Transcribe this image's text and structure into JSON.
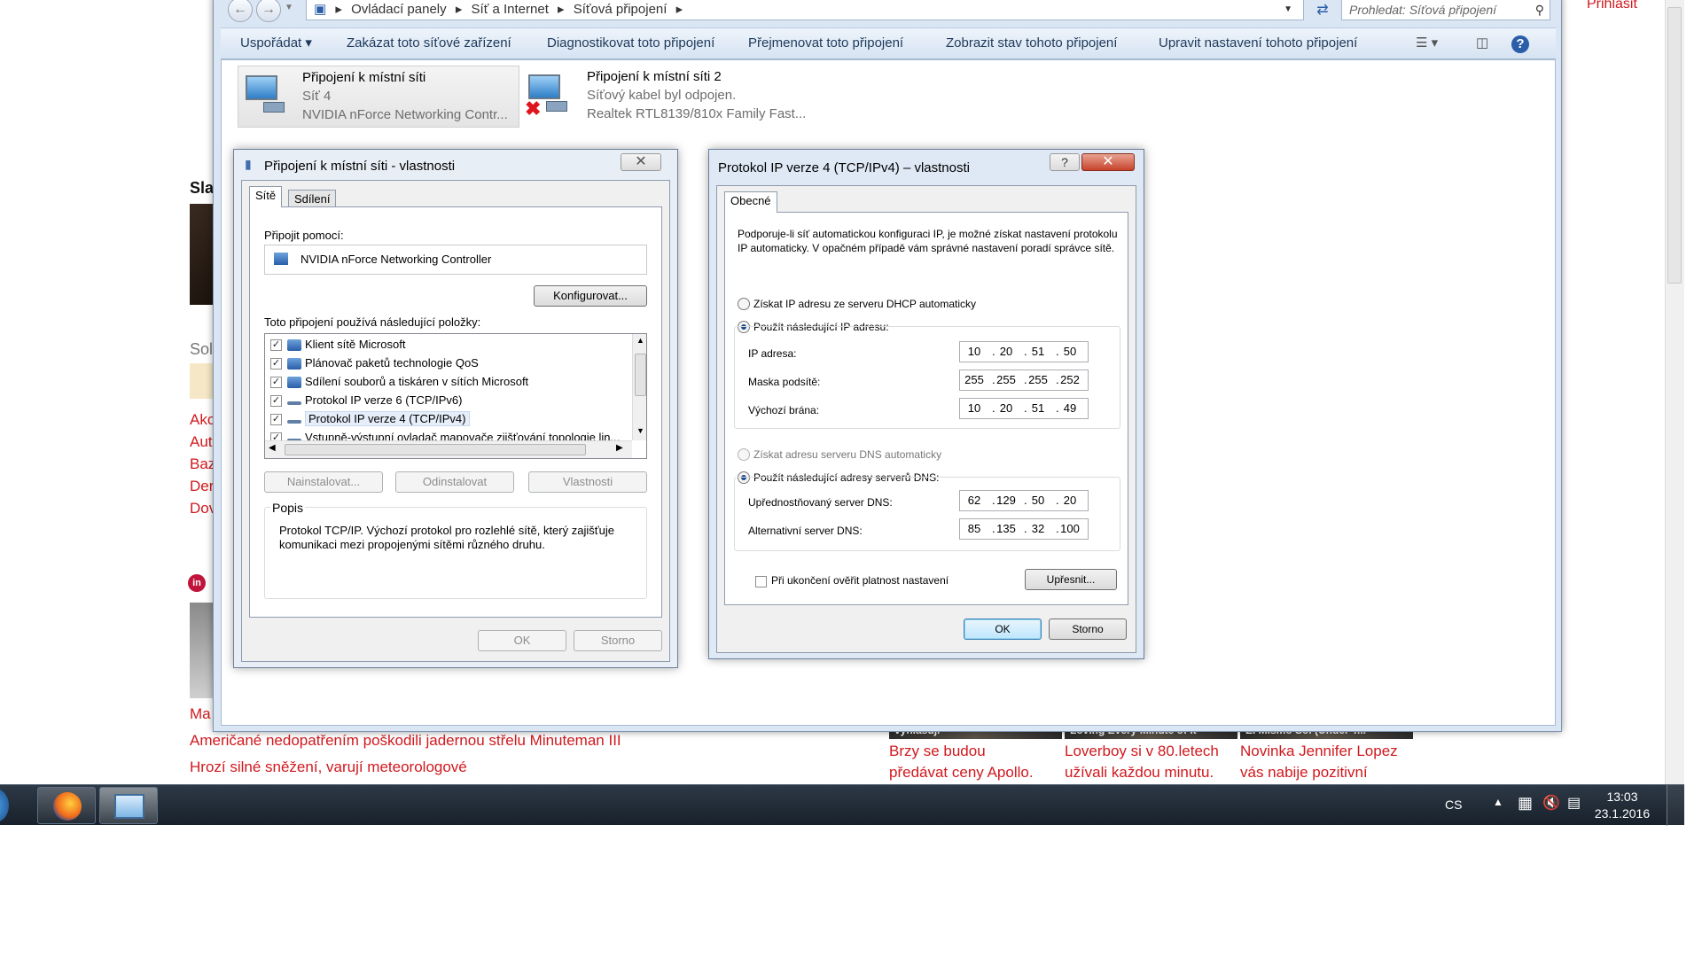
{
  "webpage": {
    "top_right_link": "Přihlásit",
    "left_fragments": [
      "Sla",
      "Sol",
      "Ako",
      "Aut",
      "Baz",
      "Der",
      "Dov",
      "Ma"
    ],
    "headlines": [
      "Američané nedopatřením poškodili jadernou střelu Minuteman III",
      "Hrozí silné sněžení, varují meteorologové"
    ],
    "news_cards": [
      {
        "caption": "Brzy se budou předávat ceny Apollo",
        "lines": [
          "Brzy se budou",
          "předávat ceny Apollo."
        ]
      },
      {
        "caption": "Loverboy si v 80.letech užívali každou minutu",
        "lines": [
          "Loverboy si v 80.letech",
          "užívali každou minutu."
        ]
      },
      {
        "caption": "Novinka Jennifer Lopez vás nabije pozitivní",
        "lines": [
          "Novinka Jennifer Lopez",
          "vás nabije pozitivní"
        ]
      }
    ],
    "strip_labels": [
      "vyhlašuji",
      "Loving Every Minute of It",
      "El Mismo Sol (Under T..."
    ],
    "brand_color": "#d0191e"
  },
  "explorer": {
    "breadcrumb": [
      "Ovládací panely",
      "Síť a Internet",
      "Síťová připojení"
    ],
    "search_placeholder": "Prohledat: Síťová připojení",
    "toolbar": [
      "Uspořádat ▾",
      "Zakázat toto síťové zařízení",
      "Diagnostikovat toto připojení",
      "Přejmenovat toto připojení",
      "Zobrazit stav tohoto připojení",
      "Upravit nastavení tohoto připojení"
    ],
    "connections": [
      {
        "name": "Připojení k místní síti",
        "status": "Síť  4",
        "adapter": "NVIDIA nForce Networking Contr..."
      },
      {
        "name": "Připojení k místní síti 2",
        "status": "Síťový kabel byl odpojen.",
        "adapter": "Realtek RTL8139/810x Family Fast..."
      }
    ]
  },
  "props_dialog": {
    "title": "Připojení k místní síti - vlastnosti",
    "tabs": [
      "Sítě",
      "Sdílení"
    ],
    "connect_using_label": "Připojit pomocí:",
    "adapter": "NVIDIA nForce Networking Controller",
    "configure_button": "Konfigurovat...",
    "items_label": "Toto připojení používá následující položky:",
    "items": [
      "Klient sítě Microsoft",
      "Plánovač paketů technologie QoS",
      "Sdílení souborů a tiskáren v sítích Microsoft",
      "Protokol IP verze 6 (TCP/IPv6)",
      "Protokol IP verze 4 (TCP/IPv4)",
      "Vstupně-výstupní ovladač mapovače zjišťování topologie lin..."
    ],
    "buttons": [
      "Nainstalovat...",
      "Odinstalovat",
      "Vlastnosti"
    ],
    "description_label": "Popis",
    "description": "Protokol TCP/IP. Výchozí protokol pro rozlehlé sítě, který zajišťuje komunikaci mezi propojenými sítěmi různého druhu.",
    "ok_button": "OK",
    "cancel_button": "Storno"
  },
  "ipv4_dialog": {
    "title": "Protokol IP verze 4 (TCP/IPv4) – vlastnosti",
    "help_glyph": "?",
    "tab": "Obecné",
    "intro": "Podporuje-li síť automatickou konfiguraci IP, je možné získat nastavení protokolu IP automaticky. V opačném případě vám správné nastavení poradí správce sítě.",
    "dhcp_auto": "Získat IP adresu ze serveru DHCP automaticky",
    "use_ip": "Použít následující IP adresu:",
    "ip_label": "IP adresa:",
    "ip": [
      "10",
      "20",
      "51",
      "50"
    ],
    "mask_label": "Maska podsítě:",
    "mask": [
      "255",
      "255",
      "255",
      "252"
    ],
    "gateway_label": "Výchozí brána:",
    "gateway": [
      "10",
      "20",
      "51",
      "49"
    ],
    "dns_auto": "Získat adresu serveru DNS automaticky",
    "use_dns": "Použít následující adresy serverů DNS:",
    "pref_dns_label": "Upřednostňovaný server DNS:",
    "pref_dns": [
      "62",
      "129",
      "50",
      "20"
    ],
    "alt_dns_label": "Alternativní server DNS:",
    "alt_dns": [
      "85",
      "135",
      "32",
      "100"
    ],
    "validate_label": "Při ukončení ověřit platnost nastavení",
    "advanced_button": "Upřesnit...",
    "ok_button": "OK",
    "cancel_button": "Storno"
  },
  "taskbar": {
    "language": "CS",
    "time": "13:03",
    "date": "23.1.2016"
  }
}
